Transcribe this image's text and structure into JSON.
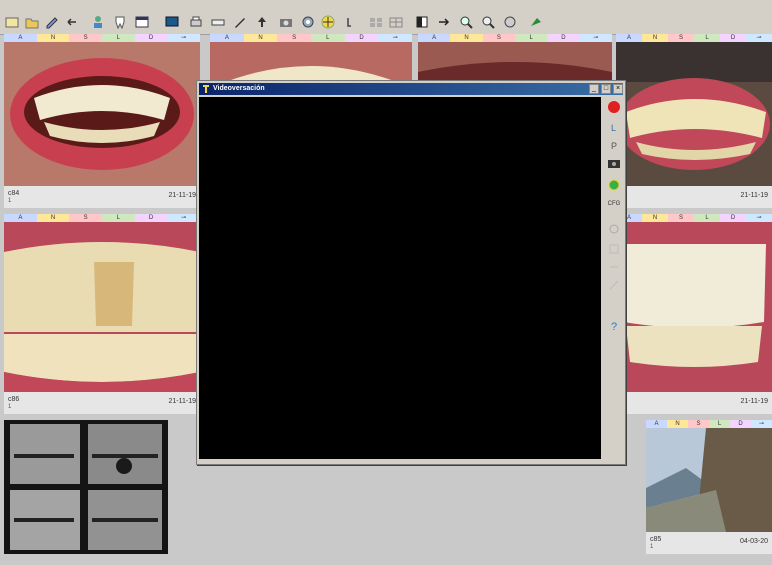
{
  "dialog": {
    "title": "Videoversación",
    "minimize": "_",
    "maximize": "□",
    "close": "×",
    "zoom_label": "CFG"
  },
  "tile_bar_letters": [
    "A",
    "N",
    "S",
    "L",
    "D",
    "⊸"
  ],
  "tiles": [
    {
      "code": "c84",
      "num": "1",
      "date": "21-11-19"
    },
    {
      "code": "",
      "num": "",
      "date": ""
    },
    {
      "code": "",
      "num": "",
      "date": ""
    },
    {
      "code": "",
      "num": "",
      "date": "21-11-19"
    },
    {
      "code": "c86",
      "num": "1",
      "date": "21-11-19"
    },
    {
      "code": "",
      "num": "",
      "date": "21-11-19"
    },
    {
      "code": "c85",
      "num": "1",
      "date": "04-03-20"
    }
  ],
  "colors": {
    "accent_titlebar": "#0a246a",
    "tile_bar_colors": [
      "#c8d8ff",
      "#ffe79a",
      "#ffc7c7",
      "#cfe8c0",
      "#f2d4ff",
      "#d0e8ff"
    ]
  }
}
